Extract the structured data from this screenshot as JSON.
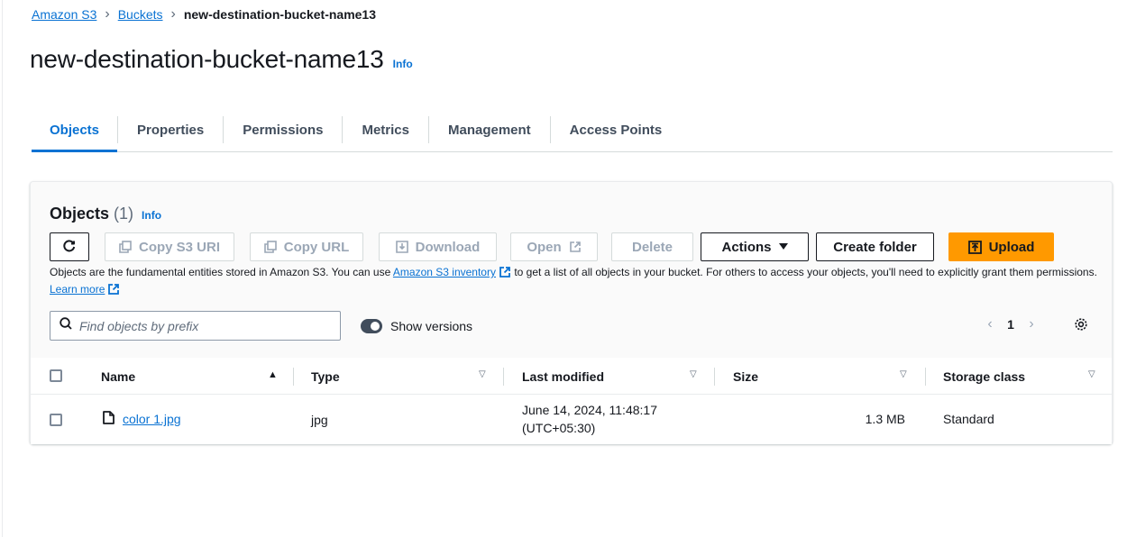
{
  "breadcrumb": {
    "items": [
      "Amazon S3",
      "Buckets"
    ],
    "current": "new-destination-bucket-name13"
  },
  "page": {
    "title": "new-destination-bucket-name13",
    "info": "Info"
  },
  "tabs": [
    "Objects",
    "Properties",
    "Permissions",
    "Metrics",
    "Management",
    "Access Points"
  ],
  "objects": {
    "title": "Objects",
    "count": "(1)",
    "info": "Info",
    "buttons": {
      "copy_s3_uri": "Copy S3 URI",
      "copy_url": "Copy URL",
      "download": "Download",
      "open": "Open",
      "delete": "Delete",
      "actions": "Actions",
      "create_folder": "Create folder",
      "upload": "Upload"
    },
    "description": {
      "part1": "Objects are the fundamental entities stored in Amazon S3. You can use ",
      "inventory_link": "Amazon S3 inventory",
      "part2": " to get a list of all objects in your bucket. For others to access your objects, you'll need to explicitly grant them permissions. ",
      "learn_more": "Learn more"
    },
    "search_placeholder": "Find objects by prefix",
    "show_versions": "Show versions",
    "pager": {
      "page": "1"
    }
  },
  "table": {
    "columns": [
      "Name",
      "Type",
      "Last modified",
      "Size",
      "Storage class"
    ],
    "rows": [
      {
        "name": "color 1.jpg",
        "type": "jpg",
        "modified_line1": "June 14, 2024, 11:48:17",
        "modified_line2": "(UTC+05:30)",
        "size": "1.3 MB",
        "storage_class": "Standard"
      }
    ]
  },
  "colors": {
    "accent": "#0972d3",
    "primary_button": "#ff9900",
    "text": "#16191f",
    "disabled": "#9ba7b6"
  }
}
